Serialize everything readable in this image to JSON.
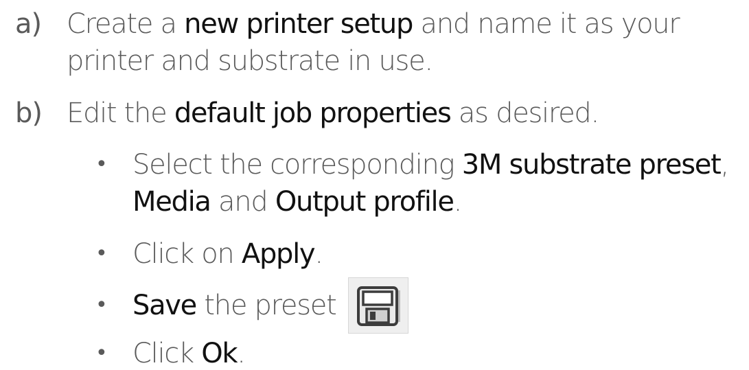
{
  "steps": [
    {
      "marker": "a)",
      "lines": [
        [
          "Create a ",
          "new printer setup",
          " and name it as your"
        ],
        [
          "printer and substrate in use."
        ]
      ]
    },
    {
      "marker": "b)",
      "lines": [
        [
          "Edit the ",
          "default job properties",
          " as desired."
        ]
      ]
    }
  ],
  "bullets": [
    {
      "line1": [
        "Select the corresponding ",
        "3M substrate preset",
        ","
      ],
      "line2": [
        "Media",
        " and ",
        "Output profile",
        "."
      ]
    },
    {
      "parts": [
        "Click on ",
        "Apply",
        "."
      ]
    },
    {
      "parts": [
        "Save",
        " the preset"
      ]
    },
    {
      "parts": [
        "Click ",
        "Ok",
        "."
      ]
    }
  ],
  "bullet_glyph": "•",
  "save_icon": "floppy-disk-icon"
}
